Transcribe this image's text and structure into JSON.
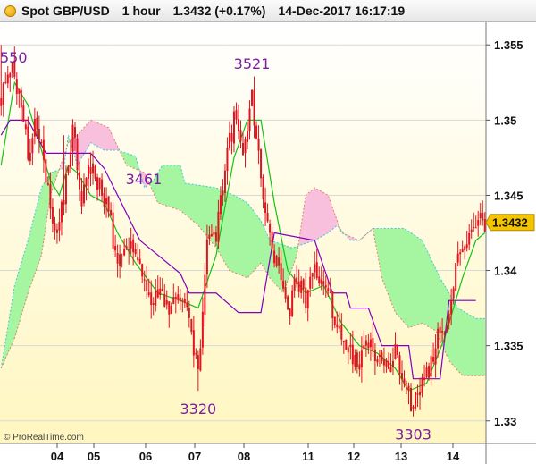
{
  "header": {
    "instrument": "Spot GBP/USD",
    "timeframe": "1 hour",
    "price_change": "1.3432 (+0.17%)",
    "timestamp": "14-Dec-2017 16:17:19"
  },
  "copyright": "© ProRealTime.com",
  "colors": {
    "candle": "#e0141e",
    "cloud_bull": "#a6f5a0",
    "cloud_bear": "#f8c0dc",
    "tenkan": "#13c313",
    "kijun": "#8000c0",
    "price_tag": "#f4c400",
    "background_top": "#ffffff",
    "background_bottom": "#fff6bf"
  },
  "chart_data": {
    "type": "candlestick",
    "title": "",
    "ylim": [
      1.3285,
      1.3565
    ],
    "y_ticks": [
      1.355,
      1.35,
      1.345,
      1.34,
      1.335,
      1.33
    ],
    "y_tick_labels": [
      "1.355",
      "1.35",
      "1.345",
      "1.34",
      "1.335",
      "1.33"
    ],
    "x_labels": [
      "04",
      "05",
      "06",
      "07",
      "08",
      "11",
      "12",
      "13",
      "14"
    ],
    "last_price": "1.3432",
    "annotations": [
      {
        "text": "550",
        "value": 1.355
      },
      {
        "text": "3521",
        "value": 1.3521
      },
      {
        "text": "3461",
        "value": 1.3461
      },
      {
        "text": "3320",
        "value": 1.332
      },
      {
        "text": "3303",
        "value": 1.3303
      }
    ],
    "close_path": [
      [
        0,
        1.3515
      ],
      [
        4,
        1.3535
      ],
      [
        8,
        1.352
      ],
      [
        12,
        1.348
      ],
      [
        16,
        1.35
      ],
      [
        20,
        1.346
      ],
      [
        24,
        1.342
      ],
      [
        28,
        1.345
      ],
      [
        32,
        1.3495
      ],
      [
        36,
        1.3445
      ],
      [
        40,
        1.347
      ],
      [
        44,
        1.3455
      ],
      [
        48,
        1.344
      ],
      [
        52,
        1.34
      ],
      [
        56,
        1.342
      ],
      [
        60,
        1.341
      ],
      [
        64,
        1.3395
      ],
      [
        68,
        1.338
      ],
      [
        72,
        1.3385
      ],
      [
        76,
        1.3375
      ],
      [
        80,
        1.338
      ],
      [
        84,
        1.337
      ],
      [
        88,
        1.333
      ],
      [
        92,
        1.342
      ],
      [
        96,
        1.342
      ],
      [
        100,
        1.347
      ],
      [
        104,
        1.35
      ],
      [
        108,
        1.348
      ],
      [
        112,
        1.3515
      ],
      [
        116,
        1.3465
      ],
      [
        120,
        1.342
      ],
      [
        124,
        1.34
      ],
      [
        128,
        1.337
      ],
      [
        132,
        1.3395
      ],
      [
        136,
        1.338
      ],
      [
        140,
        1.34
      ],
      [
        144,
        1.339
      ],
      [
        148,
        1.3375
      ],
      [
        152,
        1.3355
      ],
      [
        156,
        1.3345
      ],
      [
        160,
        1.334
      ],
      [
        164,
        1.335
      ],
      [
        168,
        1.3345
      ],
      [
        172,
        1.334
      ],
      [
        176,
        1.3345
      ],
      [
        180,
        1.332
      ],
      [
        184,
        1.331
      ],
      [
        188,
        1.3322
      ],
      [
        192,
        1.334
      ],
      [
        196,
        1.336
      ],
      [
        200,
        1.3368
      ],
      [
        204,
        1.341
      ],
      [
        208,
        1.342
      ],
      [
        212,
        1.3435
      ],
      [
        216,
        1.3432
      ]
    ],
    "tenkan_path": [
      [
        0,
        1.347
      ],
      [
        6,
        1.3525
      ],
      [
        12,
        1.351
      ],
      [
        18,
        1.348
      ],
      [
        22,
        1.346
      ],
      [
        26,
        1.345
      ],
      [
        30,
        1.347
      ],
      [
        34,
        1.3465
      ],
      [
        40,
        1.345
      ],
      [
        46,
        1.3445
      ],
      [
        52,
        1.3425
      ],
      [
        60,
        1.3405
      ],
      [
        70,
        1.3385
      ],
      [
        80,
        1.338
      ],
      [
        88,
        1.3375
      ],
      [
        96,
        1.341
      ],
      [
        104,
        1.3475
      ],
      [
        110,
        1.35
      ],
      [
        116,
        1.35
      ],
      [
        122,
        1.3445
      ],
      [
        128,
        1.34
      ],
      [
        136,
        1.3385
      ],
      [
        144,
        1.339
      ],
      [
        152,
        1.3365
      ],
      [
        160,
        1.335
      ],
      [
        168,
        1.3345
      ],
      [
        176,
        1.3335
      ],
      [
        182,
        1.332
      ],
      [
        190,
        1.3325
      ],
      [
        198,
        1.3355
      ],
      [
        206,
        1.3395
      ],
      [
        212,
        1.342
      ],
      [
        216,
        1.3425
      ]
    ],
    "kijun_path": [
      [
        0,
        1.349
      ],
      [
        4,
        1.35
      ],
      [
        12,
        1.35
      ],
      [
        20,
        1.3478
      ],
      [
        40,
        1.3478
      ],
      [
        46,
        1.3468
      ],
      [
        62,
        1.342
      ],
      [
        80,
        1.3398
      ],
      [
        84,
        1.3385
      ],
      [
        96,
        1.3385
      ],
      [
        106,
        1.3372
      ],
      [
        116,
        1.3372
      ],
      [
        122,
        1.3425
      ],
      [
        140,
        1.342
      ],
      [
        148,
        1.3385
      ],
      [
        154,
        1.3385
      ],
      [
        156,
        1.3375
      ],
      [
        164,
        1.3375
      ],
      [
        170,
        1.335
      ],
      [
        182,
        1.335
      ],
      [
        184,
        1.3328
      ],
      [
        196,
        1.3328
      ],
      [
        200,
        1.338
      ],
      [
        212,
        1.338
      ]
    ],
    "cloud_span_a": [
      [
        0,
        1.3335
      ],
      [
        6,
        1.339
      ],
      [
        12,
        1.342
      ],
      [
        18,
        1.3455
      ],
      [
        22,
        1.3465
      ],
      [
        28,
        1.3468
      ],
      [
        30,
        1.349
      ],
      [
        34,
        1.347
      ],
      [
        40,
        1.3485
      ],
      [
        46,
        1.348
      ],
      [
        52,
        1.348
      ],
      [
        60,
        1.3476
      ],
      [
        64,
        1.3455
      ],
      [
        68,
        1.346
      ],
      [
        72,
        1.347
      ],
      [
        80,
        1.347
      ],
      [
        82,
        1.3458
      ],
      [
        96,
        1.3455
      ],
      [
        104,
        1.345
      ],
      [
        110,
        1.3445
      ],
      [
        116,
        1.3433
      ],
      [
        120,
        1.342
      ],
      [
        130,
        1.3415
      ],
      [
        140,
        1.342
      ],
      [
        146,
        1.3425
      ],
      [
        150,
        1.343
      ],
      [
        156,
        1.342
      ],
      [
        160,
        1.342
      ],
      [
        166,
        1.3428
      ],
      [
        174,
        1.3428
      ],
      [
        180,
        1.3428
      ],
      [
        188,
        1.342
      ],
      [
        196,
        1.3395
      ],
      [
        204,
        1.3375
      ],
      [
        212,
        1.3368
      ],
      [
        216,
        1.3368
      ]
    ],
    "cloud_span_b": [
      [
        0,
        1.3335
      ],
      [
        6,
        1.3355
      ],
      [
        12,
        1.3385
      ],
      [
        18,
        1.341
      ],
      [
        22,
        1.345
      ],
      [
        30,
        1.3485
      ],
      [
        34,
        1.349
      ],
      [
        40,
        1.35
      ],
      [
        48,
        1.3495
      ],
      [
        56,
        1.347
      ],
      [
        64,
        1.3465
      ],
      [
        70,
        1.3445
      ],
      [
        80,
        1.344
      ],
      [
        88,
        1.343
      ],
      [
        96,
        1.3415
      ],
      [
        102,
        1.34
      ],
      [
        110,
        1.3395
      ],
      [
        116,
        1.3405
      ],
      [
        120,
        1.3395
      ],
      [
        126,
        1.3385
      ],
      [
        132,
        1.341
      ],
      [
        136,
        1.345
      ],
      [
        140,
        1.3455
      ],
      [
        146,
        1.345
      ],
      [
        152,
        1.3425
      ],
      [
        160,
        1.342
      ],
      [
        166,
        1.3428
      ],
      [
        170,
        1.3395
      ],
      [
        176,
        1.3372
      ],
      [
        182,
        1.3362
      ],
      [
        188,
        1.3365
      ],
      [
        194,
        1.336
      ],
      [
        200,
        1.334
      ],
      [
        206,
        1.333
      ],
      [
        212,
        1.333
      ],
      [
        216,
        1.333
      ]
    ]
  }
}
